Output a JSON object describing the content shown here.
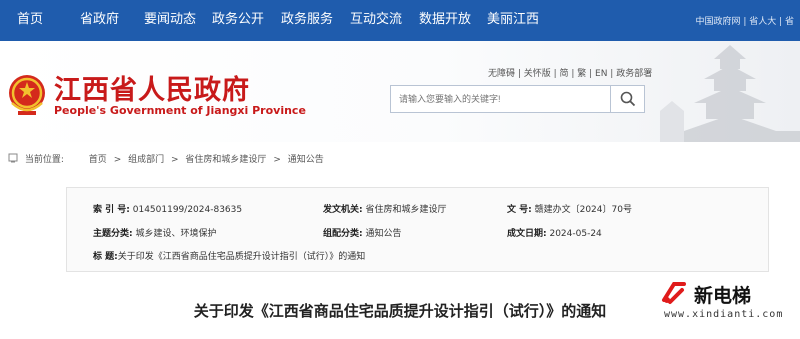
{
  "nav": {
    "items": [
      "首页",
      "省政府",
      "要闻动态",
      "政务公开",
      "政务服务",
      "互动交流",
      "数据开放",
      "美丽江西"
    ],
    "top_right": "中国政府网 | 省人大 | 省"
  },
  "header": {
    "title": "江西省人民政府",
    "subtitle": "People's Government of Jiangxi Province",
    "accessibility": "无障碍 | 关怀版 | 简 | 繁 | EN | 政务部署",
    "search_placeholder": "请输入您要输入的关键字!"
  },
  "breadcrumb": {
    "label": "当前位置:",
    "items": [
      "首页",
      ">",
      "组成部门",
      ">",
      "省住房和城乡建设厅",
      ">",
      "通知公告"
    ]
  },
  "meta": {
    "index_label": "索 引 号:",
    "index_value": "014501199/2024-83635",
    "issuer_label": "发文机关:",
    "issuer_value": "省住房和城乡建设厅",
    "docno_label": "文   号:",
    "docno_value": "赣建办文〔2024〕70号",
    "topic_label": "主题分类:",
    "topic_value": "城乡建设、环境保护",
    "genre_label": "组配分类:",
    "genre_value": "通知公告",
    "date_label": "成文日期:",
    "date_value": "2024-05-24",
    "subject_label": "标      题:",
    "subject_value": "关于印发《江西省商品住宅品质提升设计指引（试行）》的通知"
  },
  "document": {
    "title": "关于印发《江西省商品住宅品质提升设计指引（试行）》的通知"
  },
  "watermark": {
    "name": "新电梯",
    "url": "www.xindianti.com"
  },
  "colors": {
    "nav_bg": "#1f5cad",
    "title_red": "#c81a1a"
  }
}
